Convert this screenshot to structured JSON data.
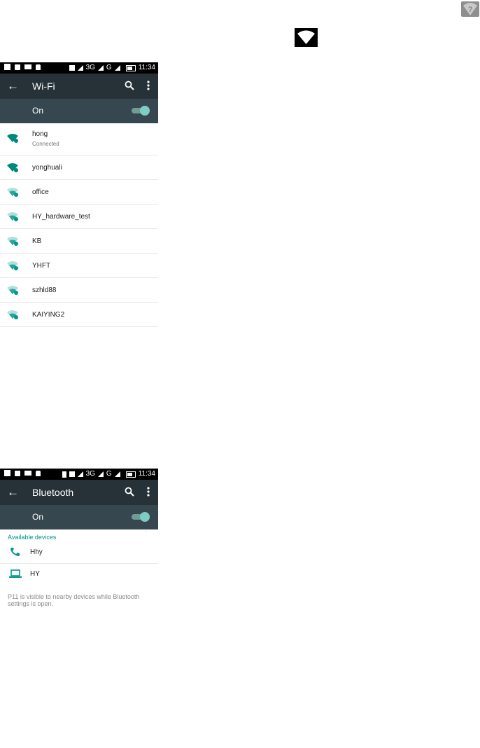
{
  "colors": {
    "accent": "#009688",
    "appbar": "#263238",
    "switchbar": "#37474f"
  },
  "float_icons": [
    "help-wifi-icon",
    "wifi-icon"
  ],
  "status_bar": {
    "time": "11:34",
    "net1": "3G",
    "net2": "G"
  },
  "wifi": {
    "title": "Wi-Fi",
    "switch_label": "On",
    "networks": [
      {
        "name": "hong",
        "status": "Connected"
      },
      {
        "name": "yonghuali"
      },
      {
        "name": "office"
      },
      {
        "name": "HY_hardware_test"
      },
      {
        "name": "KB"
      },
      {
        "name": "YHFT"
      },
      {
        "name": "szhld88"
      },
      {
        "name": "KAIYING2"
      }
    ]
  },
  "bluetooth": {
    "title": "Bluetooth",
    "switch_label": "On",
    "section_title": "Available devices",
    "devices": [
      {
        "name": "Hhy",
        "icon": "phone-icon"
      },
      {
        "name": "HY",
        "icon": "laptop-icon"
      }
    ],
    "note": "P11 is visible to nearby devices while Bluetooth settings is open."
  }
}
